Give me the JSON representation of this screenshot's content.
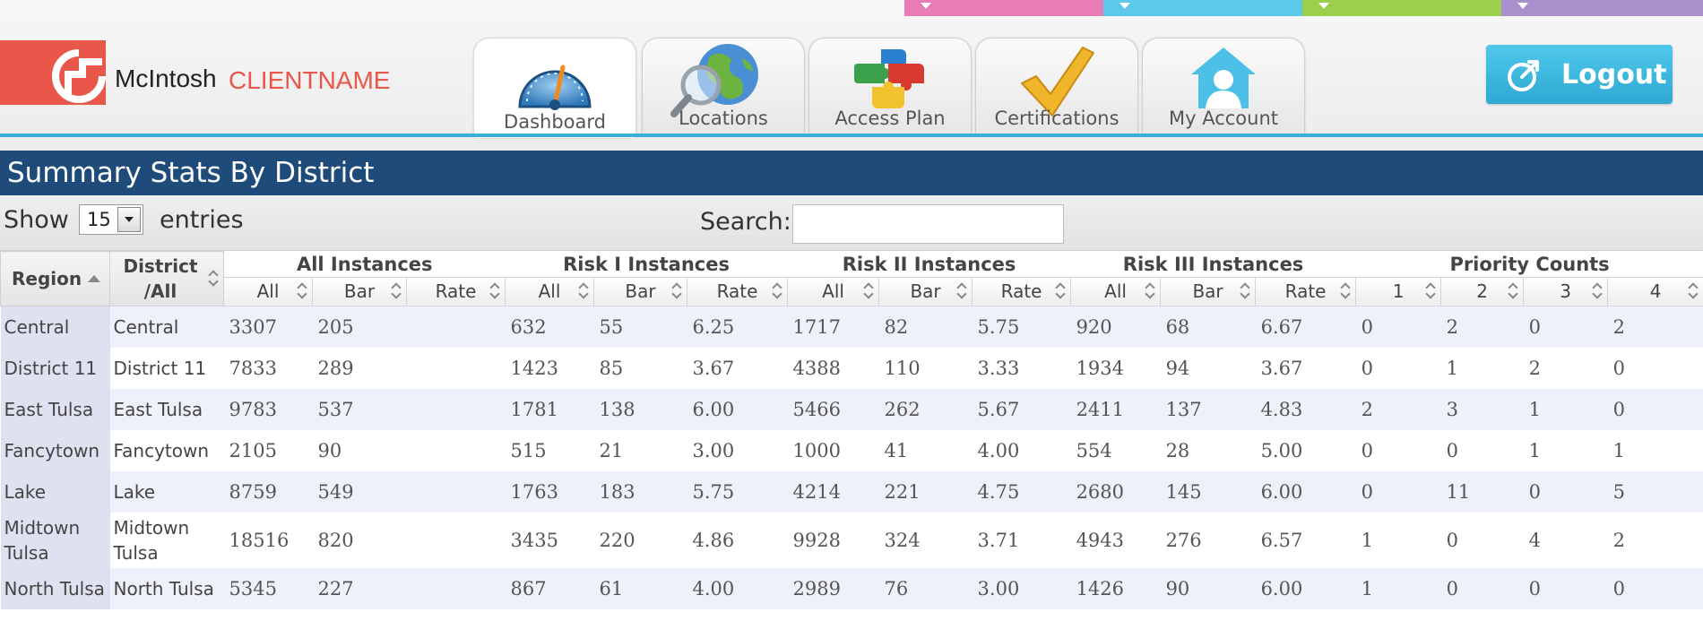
{
  "brand": {
    "name": "McIntosh",
    "client": "CLIENTNAME"
  },
  "color_strips": [
    "#e97bb5",
    "#5cc8ea",
    "#9ccf4b",
    "#a98fcc"
  ],
  "nav": {
    "tabs": [
      {
        "label": "Dashboard",
        "icon": "gauge-icon",
        "active": true
      },
      {
        "label": "Locations",
        "icon": "globe-search-icon",
        "active": false
      },
      {
        "label": "Access Plan",
        "icon": "puzzle-icon",
        "active": false
      },
      {
        "label": "Certifications",
        "icon": "checkmark-icon",
        "active": false
      },
      {
        "label": "My Account",
        "icon": "user-home-icon",
        "active": false
      }
    ],
    "logout_label": "Logout"
  },
  "page": {
    "title": "Summary Stats By District"
  },
  "controls": {
    "show_label": "Show",
    "entries_value": "15",
    "entries_label": "entries",
    "search_label": "Search:",
    "search_value": ""
  },
  "table": {
    "region_header": "Region",
    "district_header_line1": "District",
    "district_header_line2": "/All",
    "groups": [
      "All Instances",
      "Risk I Instances",
      "Risk II Instances",
      "Risk III Instances",
      "Priority Counts"
    ],
    "subheaders": [
      "All",
      "Bar",
      "Rate",
      "All",
      "Bar",
      "Rate",
      "All",
      "Bar",
      "Rate",
      "All",
      "Bar",
      "Rate",
      "1",
      "2",
      "3",
      "4"
    ],
    "rows": [
      {
        "region": "Central",
        "district": "Central",
        "values": [
          "3307",
          "205",
          "",
          "632",
          "55",
          "6.25",
          "1717",
          "82",
          "5.75",
          "920",
          "68",
          "6.67",
          "0",
          "2",
          "0",
          "2"
        ]
      },
      {
        "region": "District 11",
        "district": "District 11",
        "values": [
          "7833",
          "289",
          "",
          "1423",
          "85",
          "3.67",
          "4388",
          "110",
          "3.33",
          "1934",
          "94",
          "3.67",
          "0",
          "1",
          "2",
          "0"
        ]
      },
      {
        "region": "East Tulsa",
        "district": "East Tulsa",
        "values": [
          "9783",
          "537",
          "",
          "1781",
          "138",
          "6.00",
          "5466",
          "262",
          "5.67",
          "2411",
          "137",
          "4.83",
          "2",
          "3",
          "1",
          "0"
        ]
      },
      {
        "region": "Fancytown",
        "district": "Fancytown",
        "values": [
          "2105",
          "90",
          "",
          "515",
          "21",
          "3.00",
          "1000",
          "41",
          "4.00",
          "554",
          "28",
          "5.00",
          "0",
          "0",
          "1",
          "1"
        ]
      },
      {
        "region": "Lake",
        "district": "Lake",
        "values": [
          "8759",
          "549",
          "",
          "1763",
          "183",
          "5.75",
          "4214",
          "221",
          "4.75",
          "2680",
          "145",
          "6.00",
          "0",
          "11",
          "0",
          "5"
        ]
      },
      {
        "region": "Midtown Tulsa",
        "district": "Midtown Tulsa",
        "values": [
          "18516",
          "820",
          "",
          "3435",
          "220",
          "4.86",
          "9928",
          "324",
          "3.71",
          "4943",
          "276",
          "6.57",
          "1",
          "0",
          "4",
          "2"
        ]
      },
      {
        "region": "North Tulsa",
        "district": "North Tulsa",
        "values": [
          "5345",
          "227",
          "",
          "867",
          "61",
          "4.00",
          "2989",
          "76",
          "3.00",
          "1426",
          "90",
          "6.00",
          "1",
          "0",
          "0",
          "0"
        ]
      }
    ]
  }
}
